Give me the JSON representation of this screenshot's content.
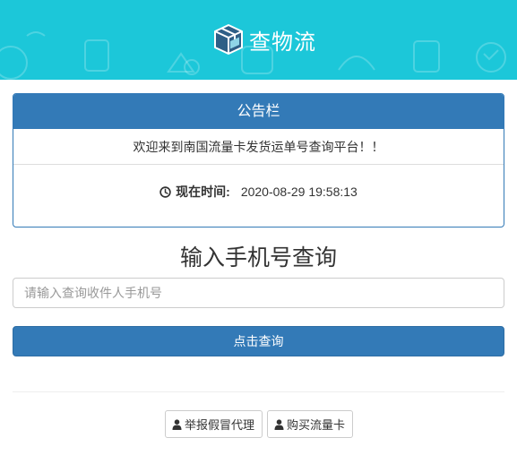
{
  "header": {
    "app_name": "查物流",
    "logo_icon": "package-box-icon",
    "background_color": "#1cc7d9"
  },
  "notice": {
    "heading": "公告栏",
    "welcome": "欢迎来到南国流量卡发货运单号查询平台！！",
    "time_label": "现在时间:",
    "time_value": "2020-08-29 19:58:13",
    "clock_icon": "clock-icon",
    "accent_color": "#337ab7"
  },
  "query": {
    "title": "输入手机号查询",
    "placeholder": "请输入查询收件人手机号",
    "value": "",
    "submit_label": "点击查询"
  },
  "footer": {
    "report_label": "举报假冒代理",
    "buy_label": "购买流量卡",
    "user_icon": "user-icon"
  }
}
